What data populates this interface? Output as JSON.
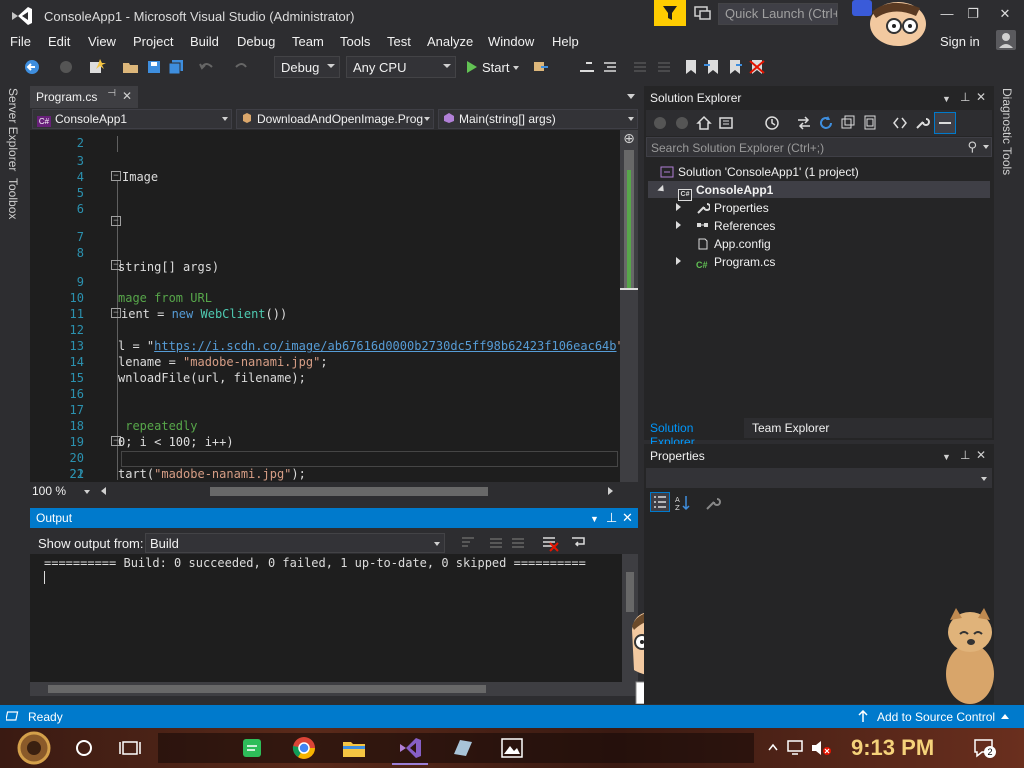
{
  "window": {
    "title": "ConsoleApp1 - Microsoft Visual Studio  (Administrator)",
    "quick_launch_placeholder": "Quick Launch (Ctrl+Q)",
    "minimize": "—",
    "restore": "❐",
    "close": "✕"
  },
  "menu": {
    "items": [
      "File",
      "Edit",
      "View",
      "Project",
      "Build",
      "Debug",
      "Team",
      "Tools",
      "Test",
      "Analyze",
      "Window",
      "Help"
    ],
    "sign_in": "Sign in"
  },
  "toolbar": {
    "config": "Debug",
    "platform": "Any CPU",
    "start_label": "Start"
  },
  "left_tabs": [
    "Server Explorer",
    "Toolbox"
  ],
  "right_tabs": [
    "Diagnostic Tools"
  ],
  "editor": {
    "tab_label": "Program.cs",
    "nav_project": "ConsoleApp1",
    "nav_class": "DownloadAndOpenImage.Prog",
    "nav_member": "Main(string[] args)",
    "zoom": "100 %",
    "line_numbers": [
      "2",
      "3",
      "4",
      "5",
      "6",
      "7",
      "8",
      "9",
      "10",
      "11",
      "12",
      "13",
      "14",
      "15",
      "16",
      "17",
      "18",
      "19",
      "20",
      "21",
      "22"
    ],
    "code": {
      "l5": "Image",
      "l9": "string[] args)",
      "l11": "mage from URL",
      "l12_a": "ient = ",
      "l12_kw": "new",
      "l12_type": "WebClient",
      "l12_b": "())",
      "l14_a": "l = \"",
      "l14_url": "https://i.scdn.co/image/ab67616d0000b2730dc5ff98b62423f106eac64b",
      "l14_b": "\";",
      "l15_a": "lename = ",
      "l15_str": "\"madobe-nanami.jpg\"",
      "l15_b": ";",
      "l16": "wnloadFile(url, filename);",
      "l19": " repeatedly",
      "l20": "0; i < 100; i++)",
      "l22_a": "tart(",
      "l22_str": "\"madobe-nanami.jpg\"",
      "l22_b": ");"
    }
  },
  "output": {
    "title": "Output",
    "show_from_label": "Show output from:",
    "source": "Build",
    "text": "========== Build: 0 succeeded, 0 failed, 1 up-to-date, 0 skipped =========="
  },
  "solution_explorer": {
    "title": "Solution Explorer",
    "search_placeholder": "Search Solution Explorer (Ctrl+;)",
    "solution": "Solution 'ConsoleApp1' (1 project)",
    "project": "ConsoleApp1",
    "items": [
      "Properties",
      "References",
      "App.config",
      "Program.cs"
    ],
    "tab_active": "Solution Explorer",
    "tab_other": "Team Explorer"
  },
  "properties": {
    "title": "Properties"
  },
  "status": {
    "ready": "Ready",
    "source_control": "Add to Source Control"
  },
  "taskbar": {
    "clock": "9:13 PM",
    "notification_count": "2"
  },
  "colors": {
    "accent": "#007acc",
    "background": "#2d2d30",
    "editor_bg": "#1e1e1e"
  }
}
